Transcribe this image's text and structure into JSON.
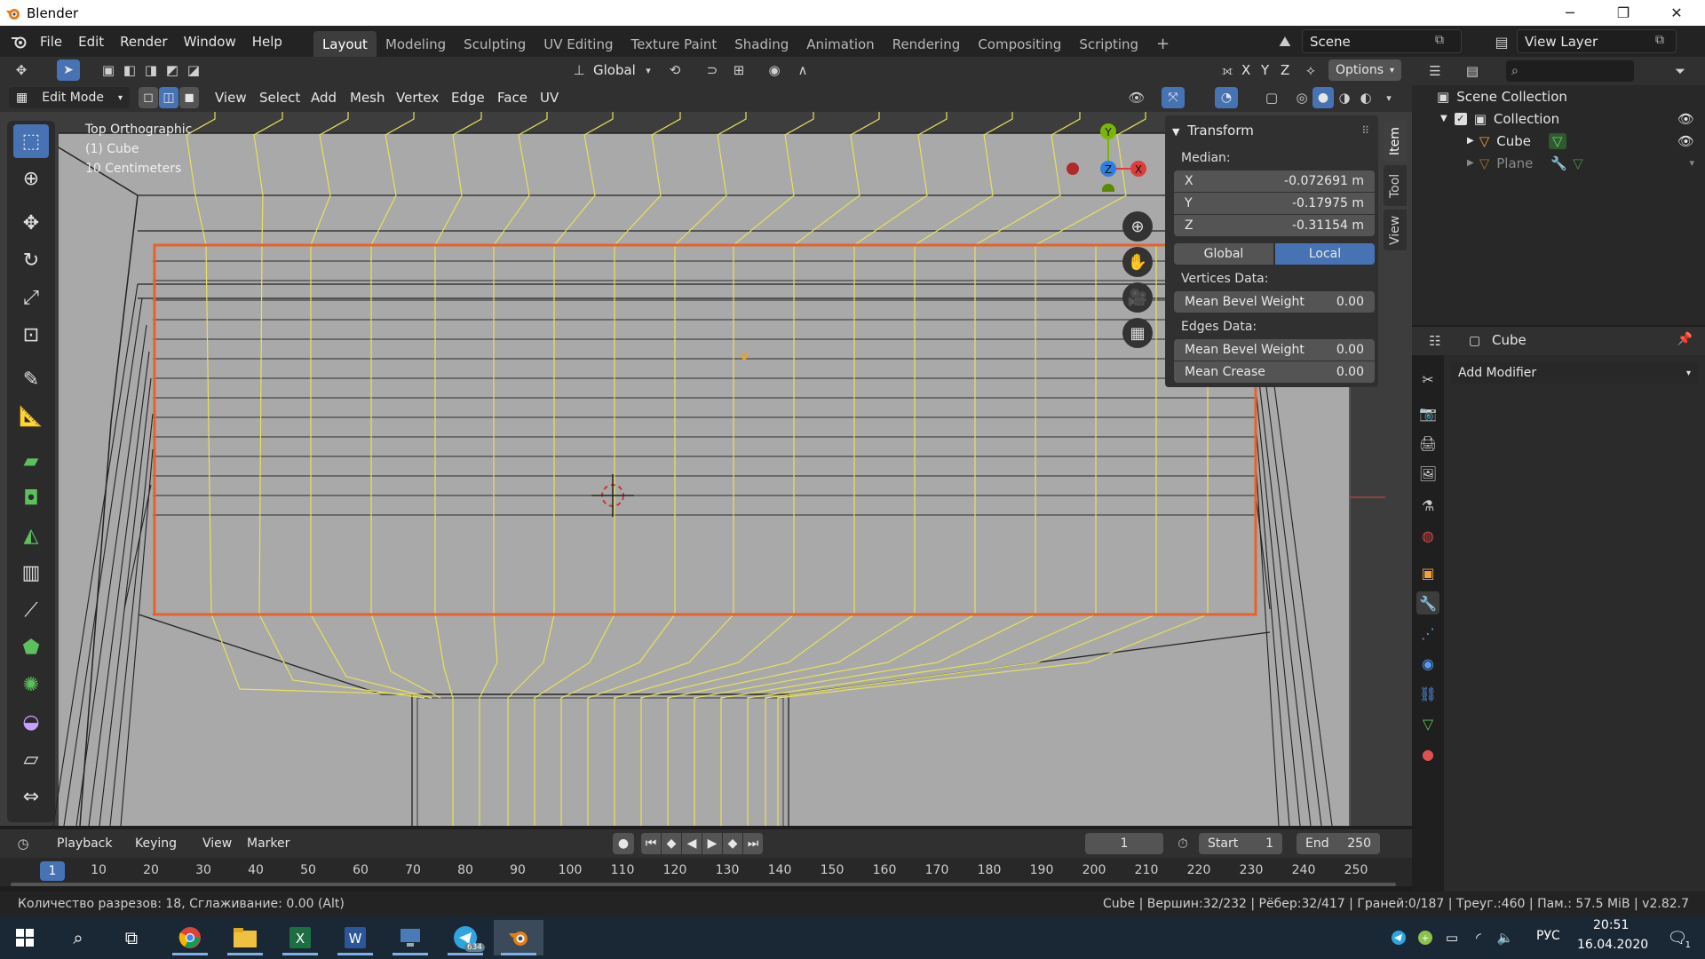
{
  "window": {
    "title": "Blender",
    "minimize_glyph": "─",
    "restore_glyph": "❐",
    "close_glyph": "✕"
  },
  "menus": [
    "File",
    "Edit",
    "Render",
    "Window",
    "Help"
  ],
  "workspaces": [
    "Layout",
    "Modeling",
    "Sculpting",
    "UV Editing",
    "Texture Paint",
    "Shading",
    "Animation",
    "Rendering",
    "Compositing",
    "Scripting"
  ],
  "workspace_add": "+",
  "scene": {
    "name": "Scene",
    "view_layer": "View Layer"
  },
  "viewport_header": {
    "transform_orientation": "Global",
    "options": "Options",
    "axes": [
      "X",
      "Y",
      "Z"
    ]
  },
  "tool_header": {
    "mode": "Edit Mode",
    "menus": [
      "View",
      "Select",
      "Add",
      "Mesh",
      "Vertex",
      "Edge",
      "Face",
      "UV"
    ]
  },
  "viewport": {
    "view_name": "Top Orthographic",
    "object_name": "(1) Cube",
    "scale": "10 Centimeters",
    "gizmo": {
      "x": "X",
      "y": "Y",
      "z": "Z"
    }
  },
  "npanel": {
    "title": "Transform",
    "median_label": "Median:",
    "x_label": "X",
    "x_value": "-0.072691 m",
    "y_label": "Y",
    "y_value": "-0.17975 m",
    "z_label": "Z",
    "z_value": "-0.31154 m",
    "global": "Global",
    "local": "Local",
    "vertices_label": "Vertices Data:",
    "vert_bevel_label": "Mean Bevel Weight",
    "vert_bevel_value": "0.00",
    "edges_label": "Edges Data:",
    "edge_bevel_label": "Mean Bevel Weight",
    "edge_bevel_value": "0.00",
    "crease_label": "Mean Crease",
    "crease_value": "0.00",
    "tabs": [
      "Item",
      "Tool",
      "View"
    ]
  },
  "outliner": {
    "root": "Scene Collection",
    "collection": "Collection",
    "items": [
      "Cube",
      "Plane"
    ]
  },
  "properties": {
    "object_name": "Cube",
    "add_modifier": "Add Modifier"
  },
  "timeline": {
    "menus": [
      "Playback",
      "Keying",
      "View",
      "Marker"
    ],
    "current_frame": "1",
    "start_label": "Start",
    "start_value": "1",
    "end_label": "End",
    "end_value": "250",
    "ticks": [
      "10",
      "20",
      "30",
      "40",
      "50",
      "60",
      "70",
      "80",
      "90",
      "100",
      "110",
      "120",
      "130",
      "140",
      "150",
      "160",
      "170",
      "180",
      "190",
      "200",
      "210",
      "220",
      "230",
      "240",
      "250"
    ],
    "current_tick": "1"
  },
  "status": {
    "left": "Количество разрезов: 18, Сглаживание: 0.00 (Alt)",
    "right": "Cube | Вершин:32/232 | Рёбер:32/417 | Граней:0/187 | Треуг.:460 | Пам.: 57.5 MiB | v2.82.7"
  },
  "taskbar": {
    "telegram_badge": "634",
    "lang": "РУС",
    "time": "20:51",
    "date": "16.04.2020",
    "notification_count": "1"
  },
  "colors": {
    "accent": "#4772b3",
    "selection_outline": "#e8612c",
    "wire_yellow": "#e8e05a",
    "background_grey": "#a9a9a9"
  }
}
